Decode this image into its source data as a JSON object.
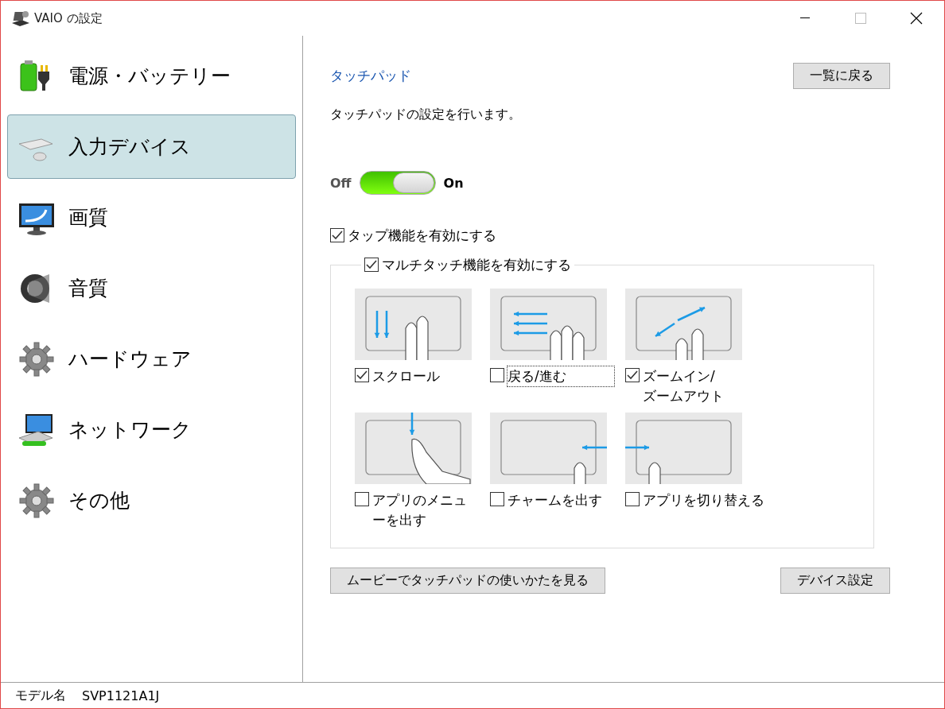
{
  "window": {
    "title": "VAIO の設定"
  },
  "sidebar": {
    "items": [
      {
        "label": "電源・バッテリー",
        "kind": "power",
        "selected": false
      },
      {
        "label": "入力デバイス",
        "kind": "input",
        "selected": true
      },
      {
        "label": "画質",
        "kind": "display",
        "selected": false
      },
      {
        "label": "音質",
        "kind": "sound",
        "selected": false
      },
      {
        "label": "ハードウェア",
        "kind": "hardware",
        "selected": false
      },
      {
        "label": "ネットワーク",
        "kind": "network",
        "selected": false
      },
      {
        "label": "その他",
        "kind": "other",
        "selected": false
      }
    ]
  },
  "content": {
    "heading": "タッチパッド",
    "back_button": "一覧に戻る",
    "description": "タッチパッドの設定を行います。",
    "toggle": {
      "off_label": "Off",
      "on_label": "On",
      "on": true
    },
    "tap": {
      "label": "タップ機能を有効にする",
      "checked": true
    },
    "multitouch": {
      "label": "マルチタッチ機能を有効にする",
      "checked": true,
      "gestures": [
        {
          "label": "スクロール",
          "kind": "scroll",
          "checked": true,
          "focused": false
        },
        {
          "label": "戻る/進む",
          "kind": "swipe",
          "checked": false,
          "focused": true
        },
        {
          "label": "ズームイン/ズームアウト",
          "kind": "zoom",
          "checked": true,
          "focused": false
        },
        {
          "label": "アプリのメニューを出す",
          "kind": "menu",
          "checked": false,
          "focused": false
        },
        {
          "label": "チャームを出す",
          "kind": "charm",
          "checked": false,
          "focused": false
        },
        {
          "label": "アプリを切り替える",
          "kind": "switch",
          "checked": false,
          "focused": false
        }
      ]
    },
    "movie_button": "ムービーでタッチパッドの使いかたを見る",
    "device_button": "デバイス設定"
  },
  "status_bar": {
    "model_label": "モデル名",
    "model": "SVP1121A1J"
  }
}
